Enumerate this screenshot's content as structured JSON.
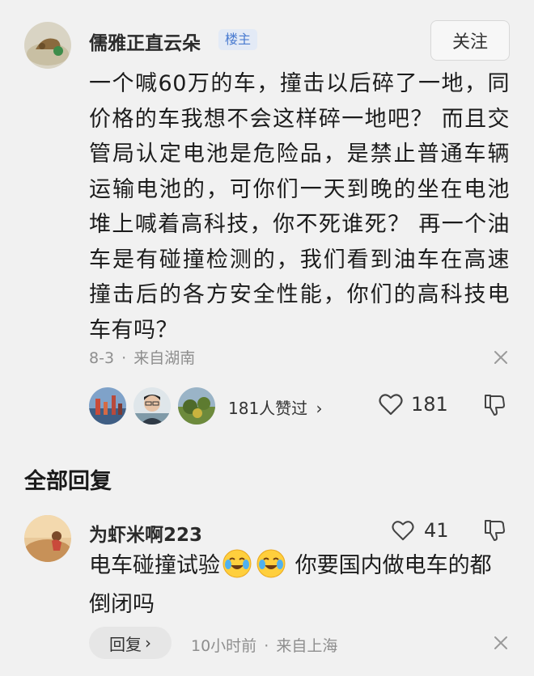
{
  "post": {
    "author": "儒雅正直云朵",
    "author_badge": "楼主",
    "follow_label": "关注",
    "content": "一个喊60万的车，撞击以后碎了一地，同价格的车我想不会这样碎一地吧？ 而且交管局认定电池是危险品，是禁止普通车辆运输电池的，可你们一天到晚的坐在电池堆上喊着高科技，你不死谁死？ 再一个油车是有碰撞检测的，我们看到油车在高速撞击后的各方安全性能，你们的高科技电车有吗？",
    "date": "8-3",
    "location": "来自湖南",
    "likers_text": "181人赞过",
    "likers_chevron": "›",
    "like_count": "181"
  },
  "replies_section": {
    "title": "全部回复"
  },
  "reply": {
    "author": "为虾米啊223",
    "like_count": "41",
    "text_before": "电车碰撞试验",
    "text_after": " 你要国内做电车的都倒闭吗",
    "reply_label": "回复",
    "reply_chevron": "›",
    "time": "10小时前",
    "location": "来自上海"
  },
  "separator": "·",
  "icons": {
    "heart": "heart-outline-icon",
    "dislike": "thumb-down-icon",
    "close": "close-icon",
    "emoji": "crying-laughing-emoji"
  },
  "colors": {
    "background": "#f1f1f1",
    "badge_text": "#4a7bd0",
    "badge_bg": "#e3eaf6",
    "meta_text": "#8e8e8e"
  }
}
